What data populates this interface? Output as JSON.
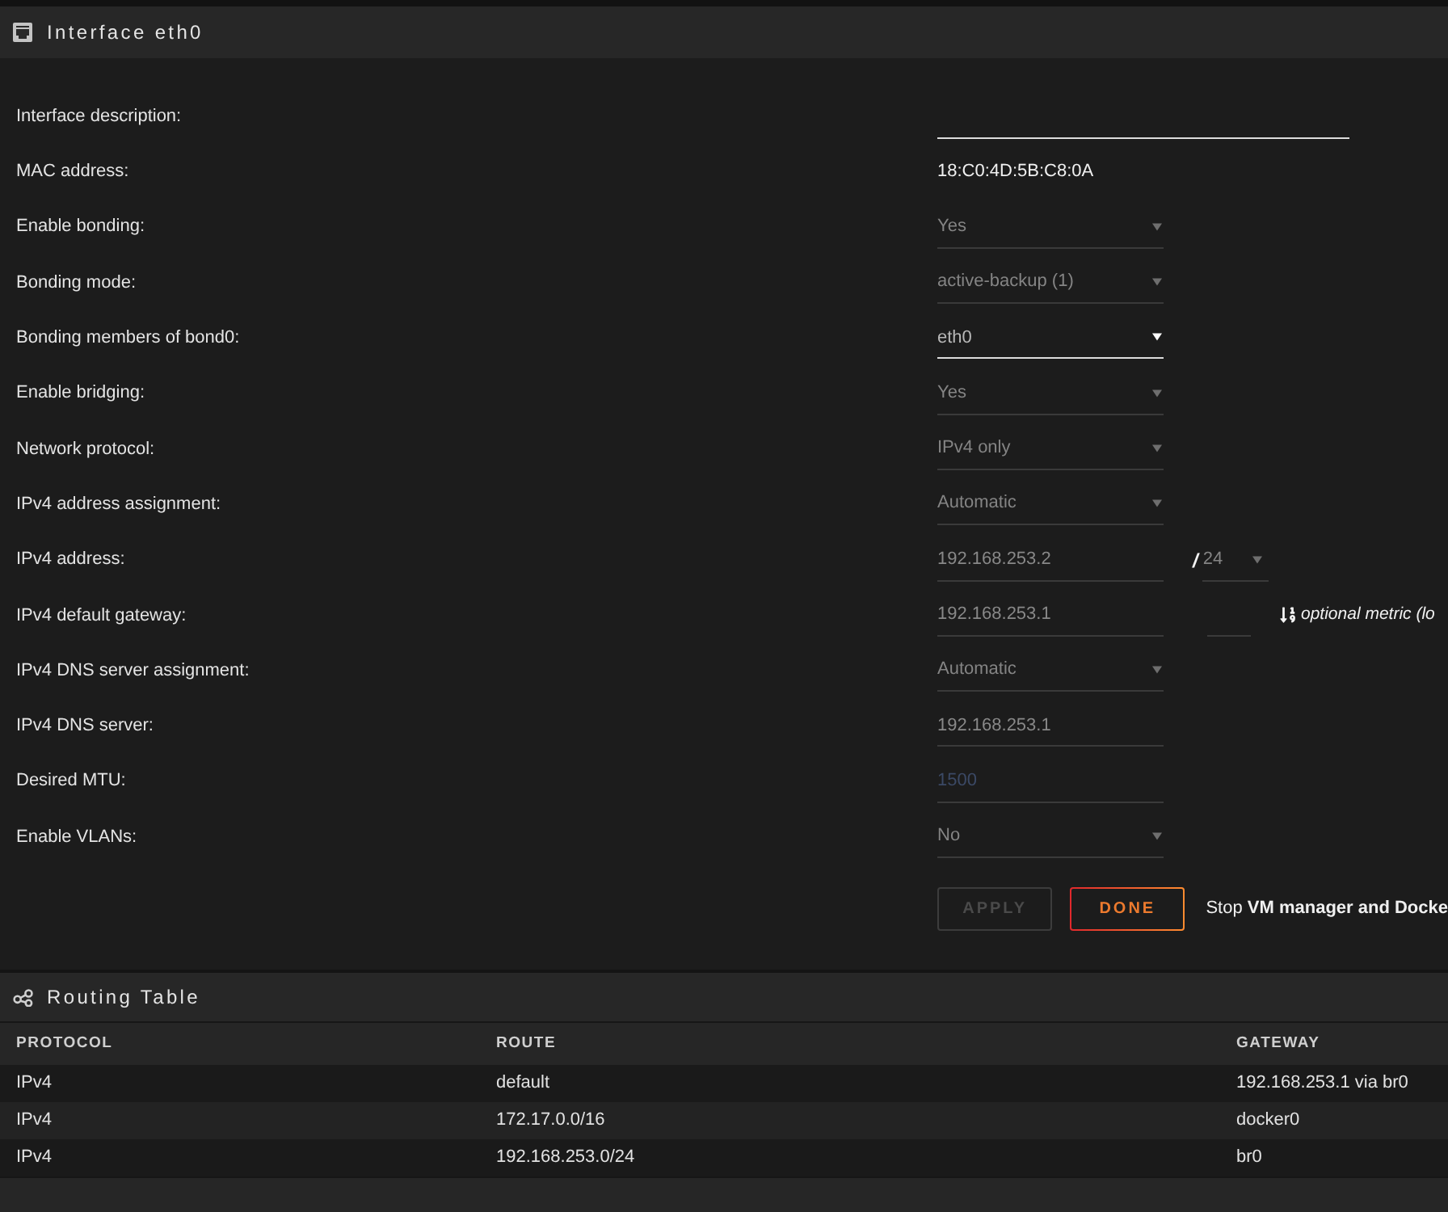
{
  "interface": {
    "title": "Interface eth0",
    "settings": [
      {
        "label": "Interface description:",
        "kind": "wide_input",
        "disabled": false
      },
      {
        "label": "MAC address:",
        "kind": "text",
        "value": "18:C0:4D:5B:C8:0A"
      },
      {
        "label": "Enable bonding:",
        "kind": "select",
        "value": "Yes",
        "disabled": true
      },
      {
        "label": "Bonding mode:",
        "kind": "select",
        "value": "active-backup (1)",
        "disabled": true
      },
      {
        "label": "Bonding members of bond0:",
        "kind": "select",
        "value": "eth0",
        "disabled": false
      },
      {
        "label": "Enable bridging:",
        "kind": "select",
        "value": "Yes",
        "disabled": true
      },
      {
        "label": "Network protocol:",
        "kind": "select",
        "value": "IPv4 only",
        "disabled": true
      },
      {
        "label": "IPv4 address assignment:",
        "kind": "select",
        "value": "Automatic",
        "disabled": true
      },
      {
        "label": "IPv4 address:",
        "kind": "input",
        "value": "192.168.253.2",
        "disabled": true,
        "netmask": {
          "separator": "/",
          "value": "24",
          "disabled": true
        }
      },
      {
        "label": "IPv4 default gateway:",
        "kind": "input",
        "value": "192.168.253.1",
        "disabled": true,
        "metric": {
          "disabled": true,
          "note": "optional metric (lo"
        }
      },
      {
        "label": "IPv4 DNS server assignment:",
        "kind": "select",
        "value": "Automatic",
        "disabled": true
      },
      {
        "label": "IPv4 DNS server:",
        "kind": "input",
        "value": "192.168.253.1",
        "disabled": true
      },
      {
        "label": "Desired MTU:",
        "kind": "input",
        "placeholder": "1500",
        "disabled": true
      },
      {
        "label": "Enable VLANs:",
        "kind": "select",
        "value": "No",
        "disabled": true
      }
    ],
    "buttons": [
      {
        "label": "APPLY",
        "disabled": true
      },
      {
        "label": "DONE",
        "disabled": false
      }
    ],
    "notice": "Stop **VM manager and Docke**"
  },
  "routing_table": {
    "title": "Routing Table",
    "columns": [
      "PROTOCOL",
      "ROUTE",
      "GATEWAY"
    ],
    "rows": [
      [
        "IPv4",
        "default",
        "192.168.253.1 via br0"
      ],
      [
        "IPv4",
        "172.17.0.0/16",
        "docker0"
      ],
      [
        "IPv4",
        "192.168.253.0/24",
        "br0"
      ]
    ]
  }
}
